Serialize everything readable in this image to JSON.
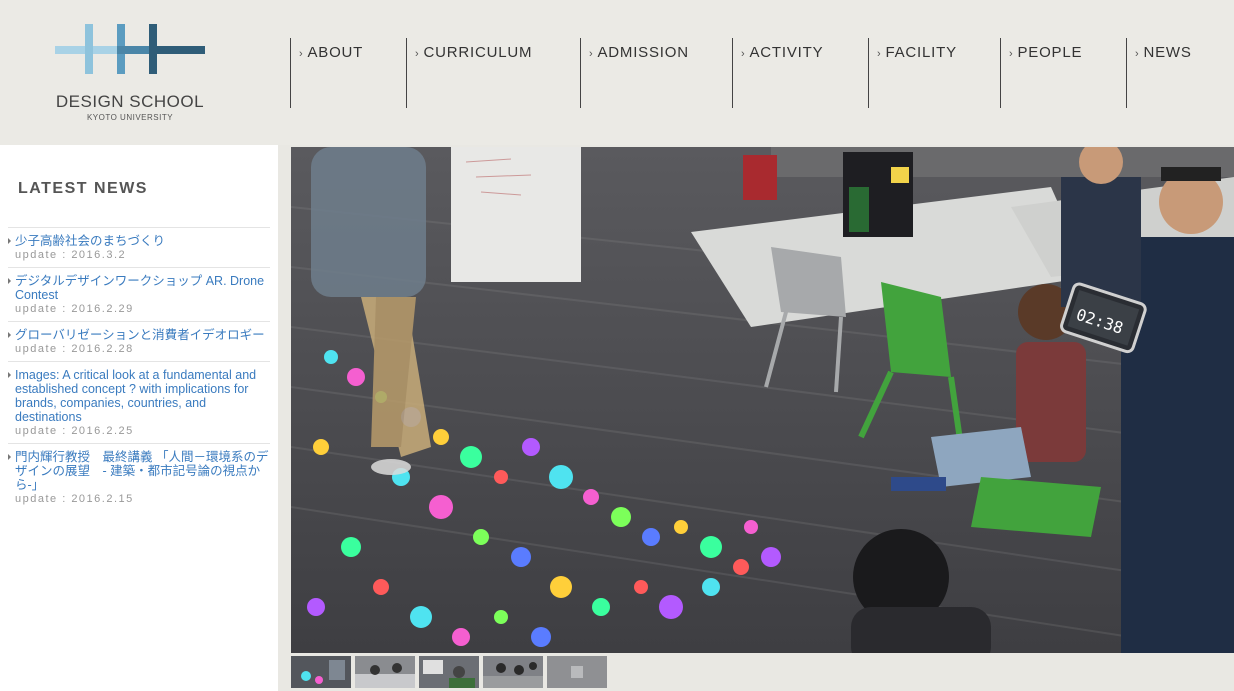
{
  "logo": {
    "title": "DESIGN SCHOOL",
    "subtitle": "KYOTO UNIVERSITY"
  },
  "nav": [
    {
      "label": "ABOUT"
    },
    {
      "label": "CURRICULUM"
    },
    {
      "label": "ADMISSION"
    },
    {
      "label": "ACTIVITY"
    },
    {
      "label": "FACILITY"
    },
    {
      "label": "PEOPLE"
    },
    {
      "label": "NEWS"
    }
  ],
  "sidebar": {
    "title": "LATEST NEWS",
    "news": [
      {
        "title": "少子高齢社会のまちづくり",
        "date": "update : 2016.3.2"
      },
      {
        "title": "デジタルデザインワークショップ AR. Drone Contest",
        "date": "update : 2016.2.29"
      },
      {
        "title": "グローバリゼーションと消費者イデオロギー",
        "date": "update : 2016.2.28"
      },
      {
        "title": "Images: A critical look at a fundamental and established concept ? with implications for brands, companies, countries, and destinations",
        "date": "update : 2016.2.25"
      },
      {
        "title": "門内輝行教授　最終講義 「人間－環境系のデザインの展望　- 建築・都市記号論の視点から-」",
        "date": "update : 2016.2.15"
      }
    ]
  },
  "hero": {
    "clock_text": "02:38"
  },
  "colors": {
    "accent": "#3a7bbf",
    "logo_light": "#8ec3dc",
    "logo_mid": "#5b9cc0",
    "logo_dark": "#2f5d78"
  }
}
